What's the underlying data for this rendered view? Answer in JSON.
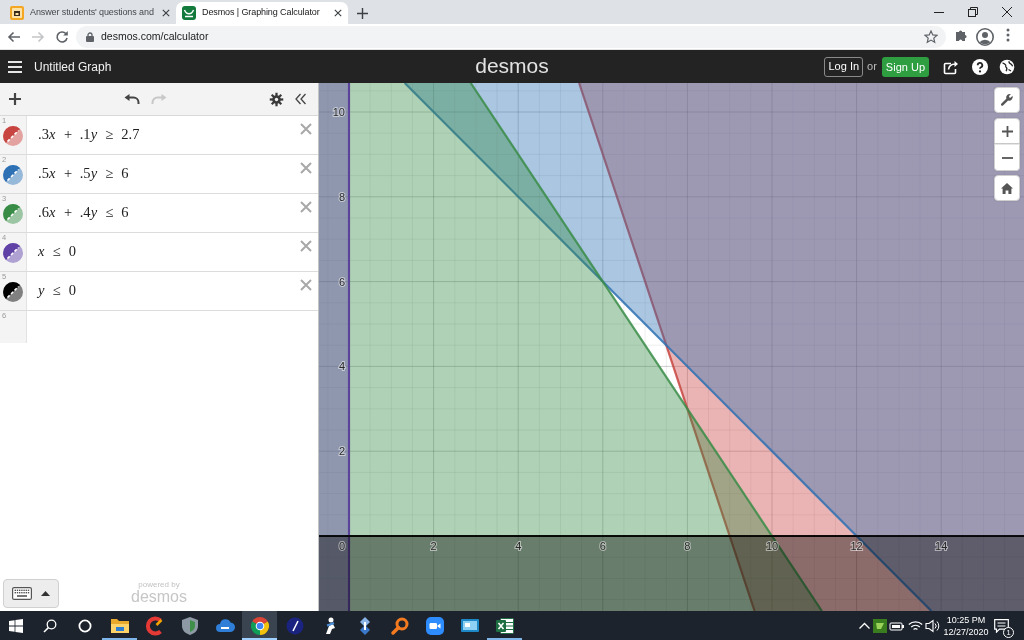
{
  "browser": {
    "tabs": [
      {
        "title": "Answer students' questions and",
        "selected": false
      },
      {
        "title": "Desmos | Graphing Calculator",
        "selected": true
      }
    ],
    "forward_disabled": true,
    "url": "desmos.com/calculator"
  },
  "header": {
    "title": "Untitled Graph",
    "logo": "desmos",
    "login_button": "Log In",
    "separator": "or",
    "signup_button": "Sign Up"
  },
  "expression_toolbar": {
    "undo_disabled": false,
    "redo_disabled": true
  },
  "expressions": [
    {
      "number": "1",
      "text": ".3x + .1y ≥ 2.7",
      "color": "#c74440"
    },
    {
      "number": "2",
      "text": ".5x + .5y ≥ 6",
      "color": "#2d70b3"
    },
    {
      "number": "3",
      "text": ".6x + .4y ≤ 6",
      "color": "#388c46"
    },
    {
      "number": "4",
      "text": "x ≤ 0",
      "color": "#6042a6"
    },
    {
      "number": "5",
      "text": "y ≤ 0",
      "color": "#000000"
    }
  ],
  "new_expression": {
    "number": "6"
  },
  "footer": {
    "powered_by": "powered by",
    "logo": "desmos"
  },
  "graph": {
    "origin_label": "0",
    "x_labels": [
      "2",
      "4",
      "6",
      "8",
      "10",
      "12",
      "14"
    ],
    "y_labels": [
      "10",
      "8",
      "6",
      "4",
      "2"
    ]
  },
  "taskbar": {
    "apps": [
      {
        "running": true,
        "selected": false
      },
      {
        "running": false,
        "selected": false
      },
      {
        "running": false,
        "selected": false
      },
      {
        "running": false,
        "selected": false
      },
      {
        "running": true,
        "selected": true
      },
      {
        "running": false,
        "selected": false
      },
      {
        "running": false,
        "selected": false
      },
      {
        "running": false,
        "selected": false
      },
      {
        "running": false,
        "selected": false
      },
      {
        "running": false,
        "selected": false
      },
      {
        "running": false,
        "selected": false
      },
      {
        "running": true,
        "selected": false
      }
    ],
    "time": "10:25 PM",
    "date": "12/27/2020",
    "notifications": "1"
  }
}
